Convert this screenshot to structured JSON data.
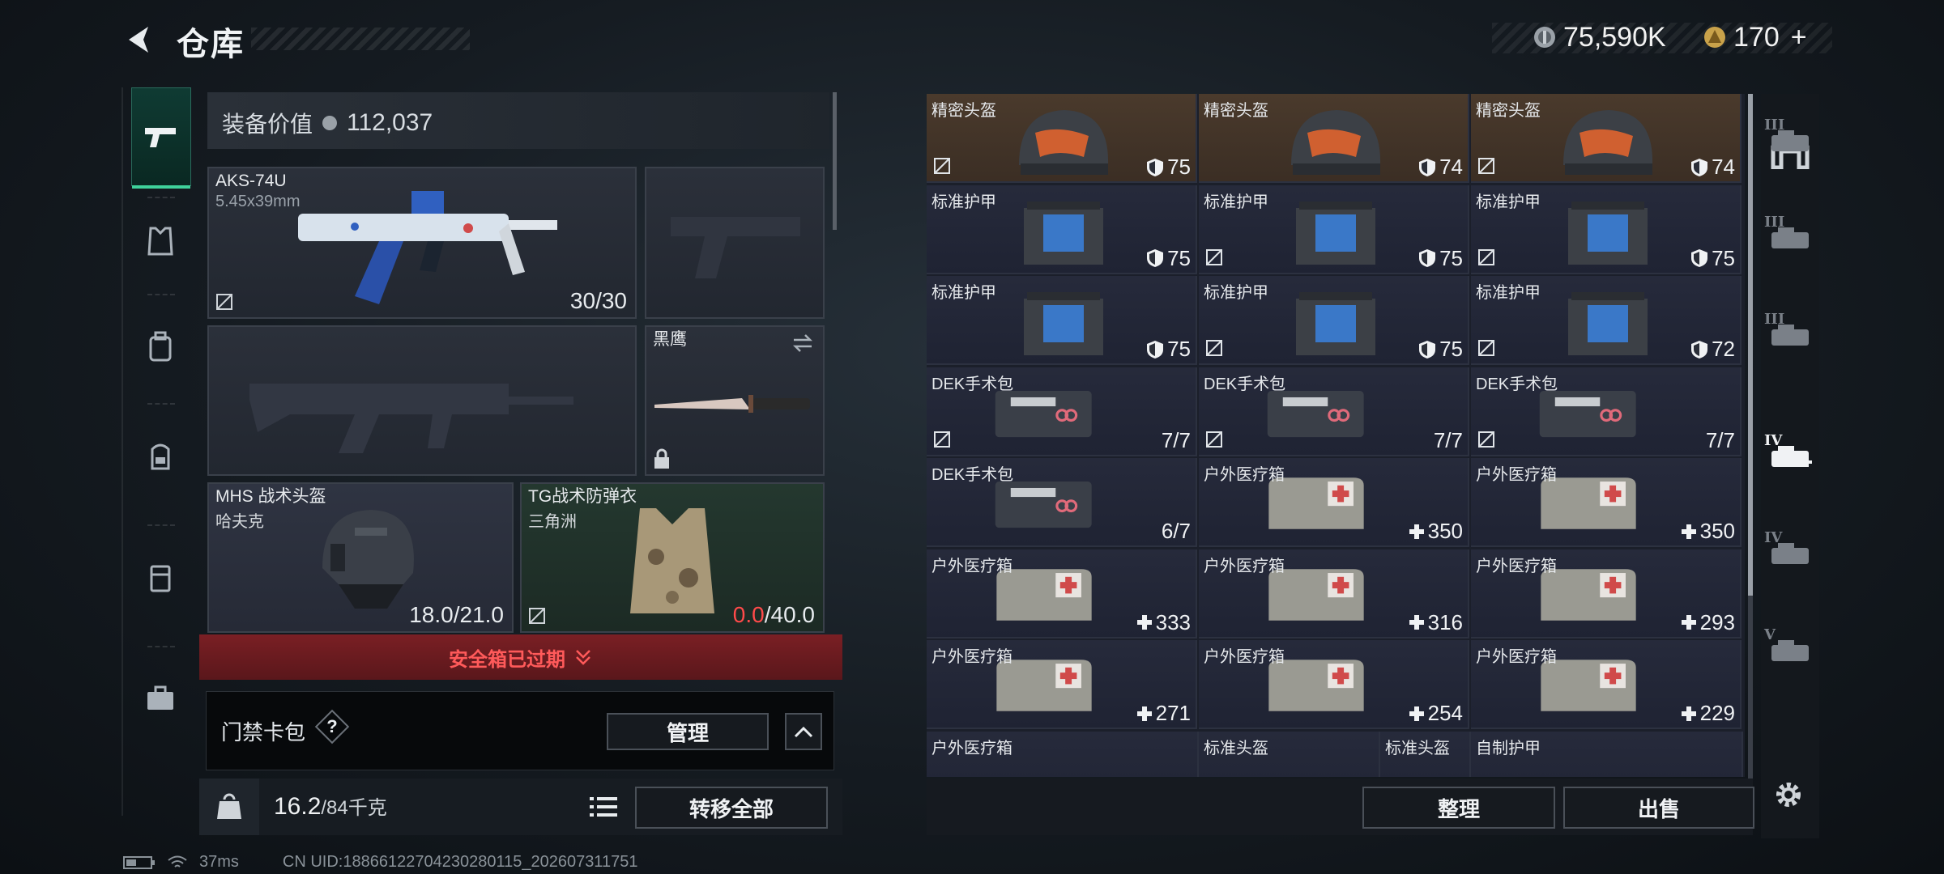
{
  "header": {
    "title": "仓库",
    "silver_amount": "75,590K",
    "gold_amount": "170",
    "plus": "+"
  },
  "equipment": {
    "value_label": "装备价值",
    "value_amount": "112,037",
    "primary": {
      "name": "AKS-74U",
      "caliber": "5.45x39mm",
      "ammo": "30/30"
    },
    "melee": {
      "name": "黑鹰"
    },
    "helmet": {
      "name": "MHS 战术头盔",
      "sub": "哈夫克",
      "durability": "18.0/21.0"
    },
    "armor": {
      "name": "TG战术防弹衣",
      "sub": "三角洲",
      "durability_current": "0.0",
      "durability_max": "/40.0"
    }
  },
  "safe_box": {
    "label": "安全箱已过期"
  },
  "keycard": {
    "label": "门禁卡包",
    "help": "?",
    "manage_label": "管理"
  },
  "inventory": {
    "weight": "16.2",
    "weight_max": "/84千克",
    "transfer_all_label": "转移全部"
  },
  "storage": {
    "items": [
      {
        "name": "精密头盔",
        "value": "75",
        "kind": "helmet",
        "brown": true,
        "notrade": true
      },
      {
        "name": "精密头盔",
        "value": "74",
        "kind": "helmet",
        "brown": true,
        "notrade": false
      },
      {
        "name": "精密头盔",
        "value": "74",
        "kind": "helmet",
        "brown": true,
        "notrade": true
      },
      {
        "name": "标准护甲",
        "value": "75",
        "kind": "armor",
        "notrade": false
      },
      {
        "name": "标准护甲",
        "value": "75",
        "kind": "armor",
        "notrade": true
      },
      {
        "name": "标准护甲",
        "value": "75",
        "kind": "armor",
        "notrade": true
      },
      {
        "name": "标准护甲",
        "value": "75",
        "kind": "armor",
        "notrade": false
      },
      {
        "name": "标准护甲",
        "value": "75",
        "kind": "armor",
        "notrade": true
      },
      {
        "name": "标准护甲",
        "value": "72",
        "kind": "armor",
        "notrade": true
      },
      {
        "name": "DEK手术包",
        "value": "7/7",
        "kind": "surgery",
        "notrade": true
      },
      {
        "name": "DEK手术包",
        "value": "7/7",
        "kind": "surgery",
        "notrade": true
      },
      {
        "name": "DEK手术包",
        "value": "7/7",
        "kind": "surgery",
        "notrade": true
      },
      {
        "name": "DEK手术包",
        "value": "6/7",
        "kind": "surgery",
        "notrade": false
      },
      {
        "name": "户外医疗箱",
        "value": "350",
        "kind": "medkit",
        "notrade": false
      },
      {
        "name": "户外医疗箱",
        "value": "350",
        "kind": "medkit",
        "notrade": false
      },
      {
        "name": "户外医疗箱",
        "value": "333",
        "kind": "medkit",
        "notrade": false
      },
      {
        "name": "户外医疗箱",
        "value": "316",
        "kind": "medkit",
        "notrade": false
      },
      {
        "name": "户外医疗箱",
        "value": "293",
        "kind": "medkit",
        "notrade": false
      },
      {
        "name": "户外医疗箱",
        "value": "271",
        "kind": "medkit",
        "notrade": false
      },
      {
        "name": "户外医疗箱",
        "value": "254",
        "kind": "medkit",
        "notrade": false
      },
      {
        "name": "户外医疗箱",
        "value": "229",
        "kind": "medkit",
        "notrade": false
      }
    ],
    "partial_items": [
      {
        "name": "户外医疗箱"
      },
      {
        "name": "标准头盔"
      },
      {
        "name": "标准头盔"
      },
      {
        "name": "自制护甲"
      }
    ],
    "sort_label": "整理",
    "sell_label": "出售"
  },
  "right_nav": {
    "tier_labels": [
      "III",
      "III",
      "III",
      "IV",
      "IV",
      "V"
    ]
  },
  "status": {
    "ping": "37ms",
    "uid": "CN UID:18866122704230280115_202607311751"
  },
  "colors": {
    "accent": "#3fd29b",
    "danger": "#ff5a5a",
    "brown_cell": "#4a3a2c"
  }
}
